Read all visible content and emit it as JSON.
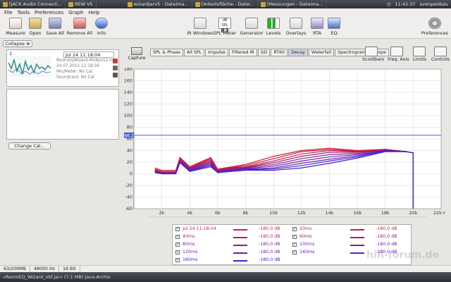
{
  "taskbar": {
    "items": [
      "[JACK Audio Connecti...",
      "REW V5",
      "wizardjarv5 - Dateima...",
      "[Arbeitsfläche - Datei...",
      "[Messungen - Dateima..."
    ],
    "clock": "11:42:37",
    "user": "svenpeldszu"
  },
  "menu": [
    "File",
    "Tools",
    "Preferences",
    "Graph",
    "Help"
  ],
  "toolbar": {
    "left": [
      "Measure",
      "Open",
      "Save All",
      "Remove All",
      "Info"
    ],
    "center": [
      "IR Windows",
      "SPL Meter",
      "Generator",
      "Levels",
      "Overlays",
      "RTA",
      "EQ"
    ],
    "spl_value": "83",
    "spl_unit": "dB SPL",
    "right": "Preferences"
  },
  "side": {
    "collapse": "Collapse",
    "measurement": {
      "index": "1",
      "name": "Jul 24 11:18:04",
      "file": "RoomEQWizard-M24Jul12.m",
      "date": "24.07.2012 11:18:04",
      "mic": "Mic/Meter: No Cal",
      "soundcard": "Soundcard: No Cal"
    },
    "change_cal": "Change Cal..."
  },
  "graph": {
    "capture": "Capture",
    "tabs": [
      "SPL & Phase",
      "All SPL",
      "Impulse",
      "Filtered IR",
      "GD",
      "RT60",
      "Decay",
      "Waterfall",
      "Spectrogram",
      "Scope"
    ],
    "active_tab": "Decay",
    "controls": [
      "Scrollbars",
      "Freq. Axis",
      "Limits",
      "Controls"
    ],
    "marker": "66.2"
  },
  "chart_data": {
    "type": "line",
    "title": "",
    "xlabel": "",
    "ylabel": "",
    "xlim": [
      0,
      22000
    ],
    "ylim": [
      -60,
      180
    ],
    "yticks": [
      180,
      160,
      140,
      120,
      100,
      80,
      60,
      40,
      20,
      0,
      -20,
      -40,
      -60
    ],
    "xticks": [
      "2k",
      "4k",
      "6k",
      "8k",
      "10k",
      "12k",
      "14k",
      "16k",
      "18k",
      "20k",
      "22k Hz"
    ],
    "reference_level": 66.2,
    "series": [
      {
        "name": "Jul 24 11:18:04",
        "color": "#d81e2e",
        "x": [
          1500,
          2000,
          3000,
          3300,
          4000,
          5500,
          6000,
          7000,
          8000,
          10000,
          12000,
          14000,
          16000,
          18000,
          19500,
          20000,
          20000
        ],
        "y": [
          10,
          6,
          6,
          28,
          12,
          28,
          8,
          12,
          16,
          30,
          40,
          44,
          40,
          42,
          38,
          36,
          -60
        ]
      },
      {
        "name": "20ms",
        "color": "#c81e46",
        "x": [
          1500,
          2000,
          3000,
          3300,
          4000,
          5500,
          6000,
          7000,
          8000,
          10000,
          12000,
          14000,
          16000,
          18000,
          19500,
          20000,
          20000
        ],
        "y": [
          8,
          4,
          4,
          26,
          11,
          26,
          7,
          11,
          14,
          26,
          38,
          42,
          39,
          42,
          38,
          36,
          -60
        ]
      },
      {
        "name": "40ms",
        "color": "#b41e5e",
        "x": [
          1500,
          2000,
          3000,
          3300,
          4000,
          5500,
          6000,
          7000,
          8000,
          10000,
          12000,
          14000,
          16000,
          18000,
          19500,
          20000,
          20000
        ],
        "y": [
          7,
          3,
          3,
          25,
          10,
          24,
          6,
          10,
          12,
          22,
          34,
          40,
          38,
          42,
          38,
          36,
          -60
        ]
      },
      {
        "name": "60ms",
        "color": "#a01e76",
        "x": [
          1500,
          2000,
          3000,
          3300,
          4000,
          5500,
          6000,
          7000,
          8000,
          10000,
          12000,
          14000,
          16000,
          18000,
          19500,
          20000,
          20000
        ],
        "y": [
          6,
          2,
          2,
          24,
          9,
          22,
          5,
          9,
          11,
          19,
          30,
          37,
          37,
          41,
          38,
          36,
          -60
        ]
      },
      {
        "name": "80ms",
        "color": "#8c1e8e",
        "x": [
          1500,
          2000,
          3000,
          3300,
          4000,
          5500,
          6000,
          7000,
          8000,
          10000,
          12000,
          14000,
          16000,
          18000,
          19500,
          20000,
          20000
        ],
        "y": [
          5,
          2,
          2,
          23,
          8,
          20,
          4,
          8,
          10,
          16,
          26,
          33,
          35,
          41,
          38,
          36,
          -60
        ]
      },
      {
        "name": "100ms",
        "color": "#7820a0",
        "x": [
          1500,
          2000,
          3000,
          3300,
          4000,
          5500,
          6000,
          7000,
          8000,
          10000,
          12000,
          14000,
          16000,
          18000,
          19500,
          20000,
          20000
        ],
        "y": [
          4,
          1,
          1,
          22,
          7,
          18,
          3,
          7,
          9,
          13,
          22,
          29,
          33,
          40,
          38,
          36,
          -60
        ]
      },
      {
        "name": "120ms",
        "color": "#6422b4",
        "x": [
          1500,
          2000,
          3000,
          3300,
          4000,
          5500,
          6000,
          7000,
          8000,
          10000,
          12000,
          14000,
          16000,
          18000,
          19500,
          20000,
          20000
        ],
        "y": [
          3,
          1,
          1,
          21,
          6,
          16,
          3,
          6,
          8,
          10,
          18,
          25,
          31,
          40,
          38,
          36,
          -60
        ]
      },
      {
        "name": "140ms",
        "color": "#5022c8",
        "x": [
          1500,
          2000,
          3000,
          3300,
          4000,
          5500,
          6000,
          7000,
          8000,
          10000,
          12000,
          14000,
          16000,
          18000,
          19500,
          20000,
          20000
        ],
        "y": [
          3,
          0,
          0,
          20,
          5,
          14,
          2,
          5,
          7,
          8,
          14,
          22,
          29,
          39,
          38,
          36,
          -60
        ]
      },
      {
        "name": "160ms",
        "color": "#3c22d8",
        "x": [
          1500,
          2000,
          3000,
          3300,
          4000,
          5500,
          6000,
          7000,
          8000,
          10000,
          12000,
          14000,
          16000,
          18000,
          19500,
          20000,
          20000
        ],
        "y": [
          2,
          0,
          0,
          19,
          4,
          12,
          2,
          4,
          6,
          6,
          10,
          18,
          27,
          38,
          38,
          36,
          -60
        ]
      }
    ]
  },
  "legend": {
    "rows": [
      {
        "left": {
          "name": "Jul 24 11:18:04",
          "val": "-180,0 dB",
          "color": "#d81e2e"
        },
        "right": {
          "name": "20ms",
          "val": "-180,0 dB",
          "color": "#c81e46"
        }
      },
      {
        "left": {
          "name": "40ms",
          "val": "-180,0 dB",
          "color": "#b41e5e"
        },
        "right": {
          "name": "60ms",
          "val": "-180,0 dB",
          "color": "#a01e76"
        }
      },
      {
        "left": {
          "name": "80ms",
          "val": "-180,0 dB",
          "color": "#8c1e8e"
        },
        "right": {
          "name": "100ms",
          "val": "-180,0 dB",
          "color": "#7820a0"
        }
      },
      {
        "left": {
          "name": "120ms",
          "val": "-180,0 dB",
          "color": "#6422b4"
        },
        "right": {
          "name": "140ms",
          "val": "-180,0 dB",
          "color": "#5022c8"
        }
      },
      {
        "left": {
          "name": "160ms",
          "val": "-180,0 dB",
          "color": "#3c22d8"
        },
        "right": null
      }
    ]
  },
  "status": [
    "63/209MB",
    "48000 Hz",
    "16 Bit"
  ],
  "bottom": "«RoomEQ_Wizard_obf.jar» (7,1 MB) Java-Archiv",
  "watermark": "hifi-forum.de"
}
